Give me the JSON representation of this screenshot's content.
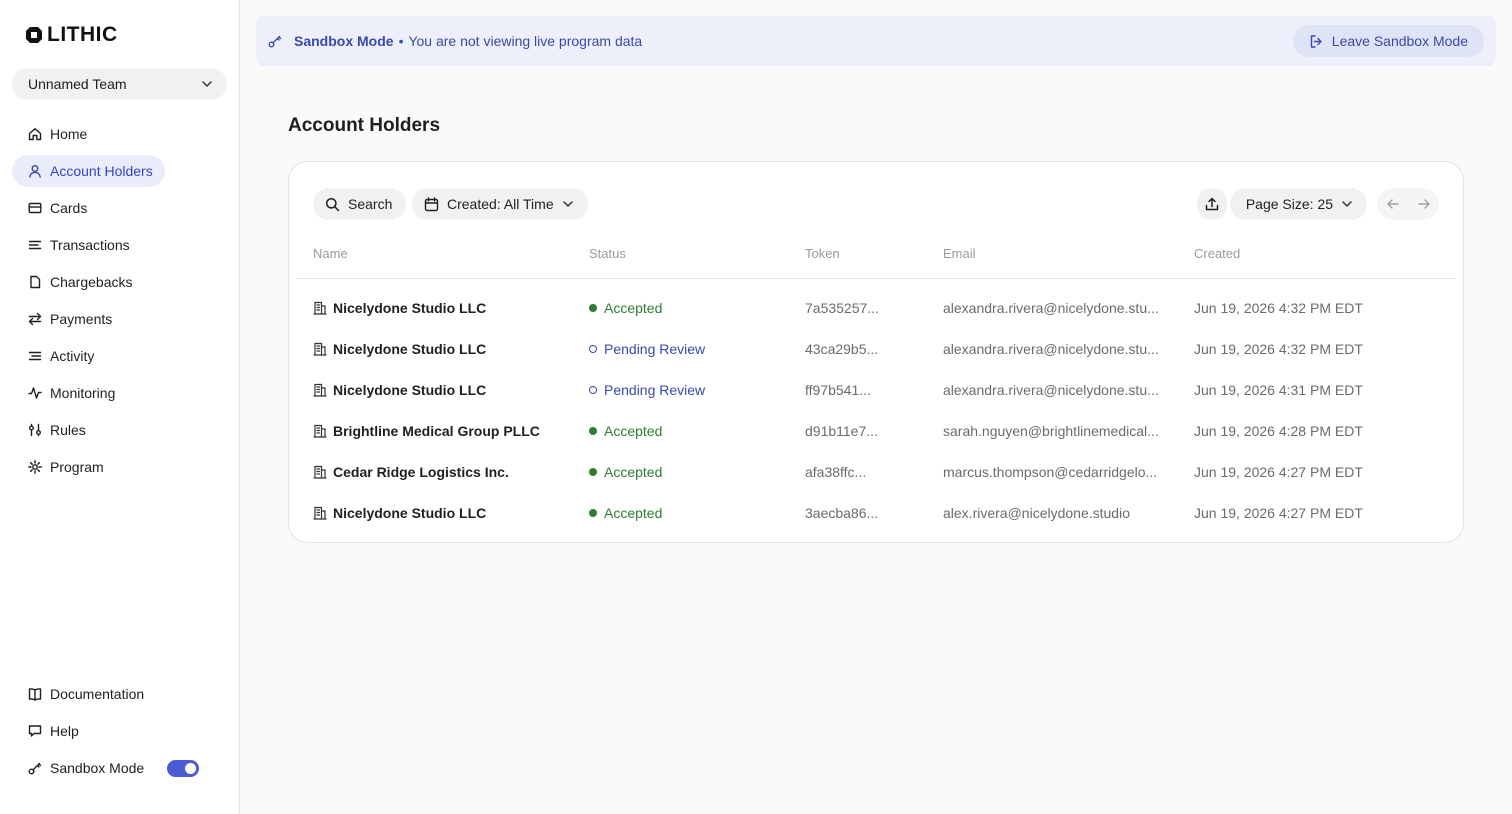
{
  "brand": {
    "logo_text": "LITHIC"
  },
  "team": {
    "name": "Unnamed Team"
  },
  "nav": [
    {
      "label": "Home",
      "icon": "home-icon",
      "active": false
    },
    {
      "label": "Account Holders",
      "icon": "user-icon",
      "active": true
    },
    {
      "label": "Cards",
      "icon": "card-icon",
      "active": false
    },
    {
      "label": "Transactions",
      "icon": "list-icon",
      "active": false
    },
    {
      "label": "Chargebacks",
      "icon": "file-icon",
      "active": false
    },
    {
      "label": "Payments",
      "icon": "swap-icon",
      "active": false
    },
    {
      "label": "Activity",
      "icon": "activity-list-icon",
      "active": false
    },
    {
      "label": "Monitoring",
      "icon": "pulse-icon",
      "active": false
    },
    {
      "label": "Rules",
      "icon": "sliders-icon",
      "active": false
    },
    {
      "label": "Program",
      "icon": "gear-icon",
      "active": false
    }
  ],
  "nav_bottom": [
    {
      "label": "Documentation",
      "icon": "book-icon"
    },
    {
      "label": "Help",
      "icon": "chat-icon"
    },
    {
      "label": "Sandbox Mode",
      "icon": "key-icon",
      "toggle_on": true
    }
  ],
  "banner": {
    "mode_label": "Sandbox Mode",
    "separator": "•",
    "message": "You are not viewing live program data",
    "leave_label": "Leave Sandbox Mode"
  },
  "page": {
    "title": "Account Holders"
  },
  "toolbar": {
    "search_label": "Search",
    "created_filter_label": "Created: All Time",
    "page_size_label": "Page Size: 25"
  },
  "table": {
    "columns": [
      "Name",
      "Status",
      "Token",
      "Email",
      "Created"
    ],
    "rows": [
      {
        "name": "Nicelydone Studio LLC",
        "status": "Accepted",
        "token": "7a535257...",
        "email": "alexandra.rivera@nicelydone.stu...",
        "created": "Jun 19, 2026 4:32 PM EDT"
      },
      {
        "name": "Nicelydone Studio LLC",
        "status": "Pending Review",
        "token": "43ca29b5...",
        "email": "alexandra.rivera@nicelydone.stu...",
        "created": "Jun 19, 2026 4:32 PM EDT"
      },
      {
        "name": "Nicelydone Studio LLC",
        "status": "Pending Review",
        "token": "ff97b541...",
        "email": "alexandra.rivera@nicelydone.stu...",
        "created": "Jun 19, 2026 4:31 PM EDT"
      },
      {
        "name": "Brightline Medical Group PLLC",
        "status": "Accepted",
        "token": "d91b11e7...",
        "email": "sarah.nguyen@brightlinemedical...",
        "created": "Jun 19, 2026 4:28 PM EDT"
      },
      {
        "name": "Cedar Ridge Logistics Inc.",
        "status": "Accepted",
        "token": "afa38ffc...",
        "email": "marcus.thompson@cedarridgelo...",
        "created": "Jun 19, 2026 4:27 PM EDT"
      },
      {
        "name": "Nicelydone Studio LLC",
        "status": "Accepted",
        "token": "3aecba86...",
        "email": "alex.rivera@nicelydone.studio",
        "created": "Jun 19, 2026 4:27 PM EDT"
      }
    ]
  },
  "colors": {
    "accent": "#3949ab",
    "accepted": "#2e7d32",
    "active_nav_bg": "#e9ecf9",
    "toggle": "#4c5bd4"
  }
}
